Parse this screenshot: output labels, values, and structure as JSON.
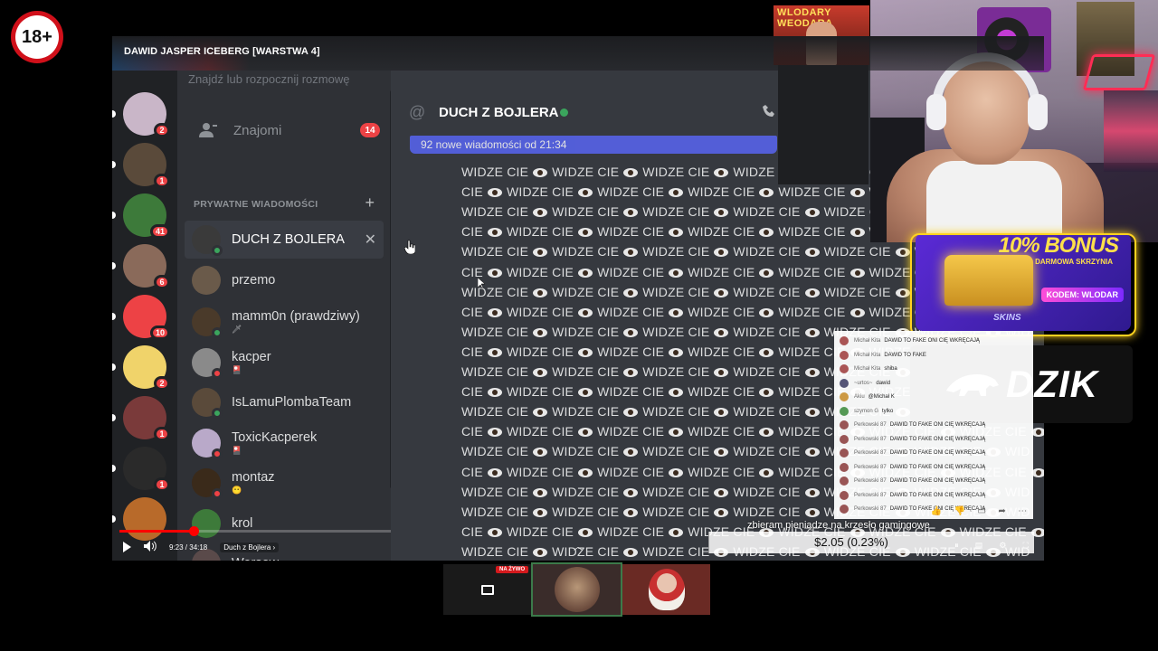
{
  "overlay": {
    "age_badge": "18+"
  },
  "video": {
    "title": "DAWID JASPER ICEBERG [WARSTWA 4]",
    "time": "9:23 / 34:18",
    "chapter": "Duch z Bojlera",
    "progress": 0.274
  },
  "discord": {
    "search_placeholder": "Znajdź lub rozpocznij rozmowę",
    "friends_label": "Znajomi",
    "friends_badge": "14",
    "dm_header": "PRYWATNE WIADOMOŚCI",
    "servers": [
      {
        "badge": "2",
        "color": "#c9b6c8"
      },
      {
        "badge": "1",
        "color": "#5a4a3a"
      },
      {
        "badge": "41",
        "color": "#3d7a3a"
      },
      {
        "badge": "6",
        "color": "#8a6a5a"
      },
      {
        "badge": "10",
        "color": "#ed4245"
      },
      {
        "badge": "2",
        "color": "#f0d36a"
      },
      {
        "badge": "1",
        "color": "#7a3a3a"
      },
      {
        "badge": "1",
        "color": "#2a2a2a"
      },
      {
        "badge": "",
        "color": "#b86a2a"
      }
    ],
    "dms": [
      {
        "name": "DUCH Z BOJLERA",
        "sub": "",
        "status": "online",
        "avatar": "#3a3a3a"
      },
      {
        "name": "przemo",
        "sub": "",
        "status": "",
        "avatar": "#6a5a4a"
      },
      {
        "name": "mamm0n (prawdziwy)",
        "sub": "🗡",
        "status": "online",
        "avatar": "#4a3a2a"
      },
      {
        "name": "kacper",
        "sub": "🎴",
        "status": "dnd",
        "avatar": "#8a8a8a"
      },
      {
        "name": "IsLamuPlombaTeam",
        "sub": "",
        "status": "online",
        "avatar": "#5a4a3a"
      },
      {
        "name": "ToxicKacperek",
        "sub": "🎴",
        "status": "dnd",
        "avatar": "#b9a9c9"
      },
      {
        "name": "montaz",
        "sub": "😶",
        "status": "dnd",
        "avatar": "#3a2a1a"
      },
      {
        "name": "krol",
        "sub": "",
        "status": "",
        "avatar": "#3d7a3a"
      },
      {
        "name": "Wersow",
        "sub": "",
        "status": "",
        "avatar": "#5a4a4a"
      }
    ],
    "chat": {
      "channel_at": "@",
      "channel_name": "DUCH Z BOJLERA",
      "new_messages": "92 nowe wiadomości od 21:34",
      "spam_word": "WIDZE CIE",
      "spam_lines": [
        {
          "prefix": "",
          "count": 5,
          "suffix": "WIDZ"
        },
        {
          "prefix": "CIE",
          "count": 5,
          "suffix": "WIDZ"
        },
        {
          "prefix": "",
          "count": 5,
          "suffix": "WIDZ"
        },
        {
          "prefix": "CIE",
          "count": 6,
          "suffix": "WIDZE CIE"
        },
        {
          "prefix": "",
          "count": 6,
          "suffix": "WID"
        },
        {
          "prefix": "CIE",
          "count": 6,
          "suffix": "WIDZE CIE"
        },
        {
          "prefix": "",
          "count": 6,
          "suffix": "WID"
        },
        {
          "prefix": "CIE",
          "count": 6,
          "suffix": "WIDZE CIE"
        },
        {
          "prefix": "",
          "count": 6,
          "suffix": "WID"
        },
        {
          "prefix": "CIE",
          "count": 6,
          "suffix": "WIDZE CIE"
        },
        {
          "prefix": "",
          "count": 6,
          "suffix": "WID"
        },
        {
          "prefix": "CIE",
          "count": 6,
          "suffix": "WIDZE CIE"
        },
        {
          "prefix": "",
          "count": 6,
          "suffix": "WID"
        },
        {
          "prefix": "CIE",
          "count": 6,
          "suffix": "WIDZE CIE"
        },
        {
          "prefix": "",
          "count": 6,
          "suffix": "WID"
        },
        {
          "prefix": "CIE",
          "count": 6,
          "suffix": "WIDZE CIE"
        },
        {
          "prefix": "",
          "count": 6,
          "suffix": "WID"
        },
        {
          "prefix": "",
          "count": 6,
          "suffix": "WID"
        },
        {
          "prefix": "CIE",
          "count": 6,
          "suffix": "WIDZE CIE"
        },
        {
          "prefix": "",
          "count": 6,
          "suffix": "WID"
        },
        {
          "prefix": "CIE",
          "count": 2,
          "suffix": ""
        },
        {
          "prefix": "",
          "count": 6,
          "suffix": "WIDZE CIE"
        }
      ]
    }
  },
  "sponsor": {
    "bonus": "10% BONUS",
    "bonus_sub": "DARMOWA SKRZYNIA",
    "code": "KODEM: WLODAR",
    "brand": "SKINS",
    "dzik": "DZIK",
    "wlodary": "WLODARY WEODARA"
  },
  "stream_chat": {
    "rows": [
      {
        "name": "Michał Kita",
        "msg": "DAWID TO FAKE ONI CIĘ WKRĘCAJĄ",
        "color": "#a55"
      },
      {
        "name": "Michał Kita",
        "msg": "DAWID TO FAKE",
        "color": "#a55"
      },
      {
        "name": "Michał Kita",
        "msg": "shiba",
        "color": "#a55"
      },
      {
        "name": "~urtos~",
        "msg": "dawid",
        "color": "#557"
      },
      {
        "name": "Akiu",
        "msg": "@Michał K",
        "color": "#c94"
      },
      {
        "name": "szymon G",
        "msg": "tylko",
        "color": "#595"
      },
      {
        "name": "Perkowski 87",
        "msg": "DAWID TO FAKE ONI CIĘ WKRĘCAJĄ",
        "color": "#955"
      },
      {
        "name": "Perkowski 87",
        "msg": "DAWID TO FAKE ONI CIĘ WKRĘCAJĄ",
        "color": "#955"
      },
      {
        "name": "Perkowski 87",
        "msg": "DAWID TO FAKE ONI CIĘ WKRĘCAJĄ",
        "color": "#955"
      },
      {
        "name": "Perkowski 87",
        "msg": "DAWID TO FAKE ONI CIĘ WKRĘCAJĄ",
        "color": "#955"
      },
      {
        "name": "Perkowski 87",
        "msg": "DAWID TO FAKE ONI CIĘ WKRĘCAJĄ",
        "color": "#955"
      },
      {
        "name": "Perkowski 87",
        "msg": "DAWID TO FAKE ONI CIĘ WKRĘCAJĄ",
        "color": "#955"
      },
      {
        "name": "Perkowski 87",
        "msg": "DAWID TO FAKE ONI CIĘ WKRĘCAJĄ",
        "color": "#955"
      }
    ]
  },
  "donation": {
    "goal_text": "zbieram pieniądze na krzesło gamingowe",
    "amount": "$2.05 (0.23%)",
    "fraction": 0.0023
  },
  "thumbnails": {
    "live_badge": "NA ŻYWO"
  }
}
